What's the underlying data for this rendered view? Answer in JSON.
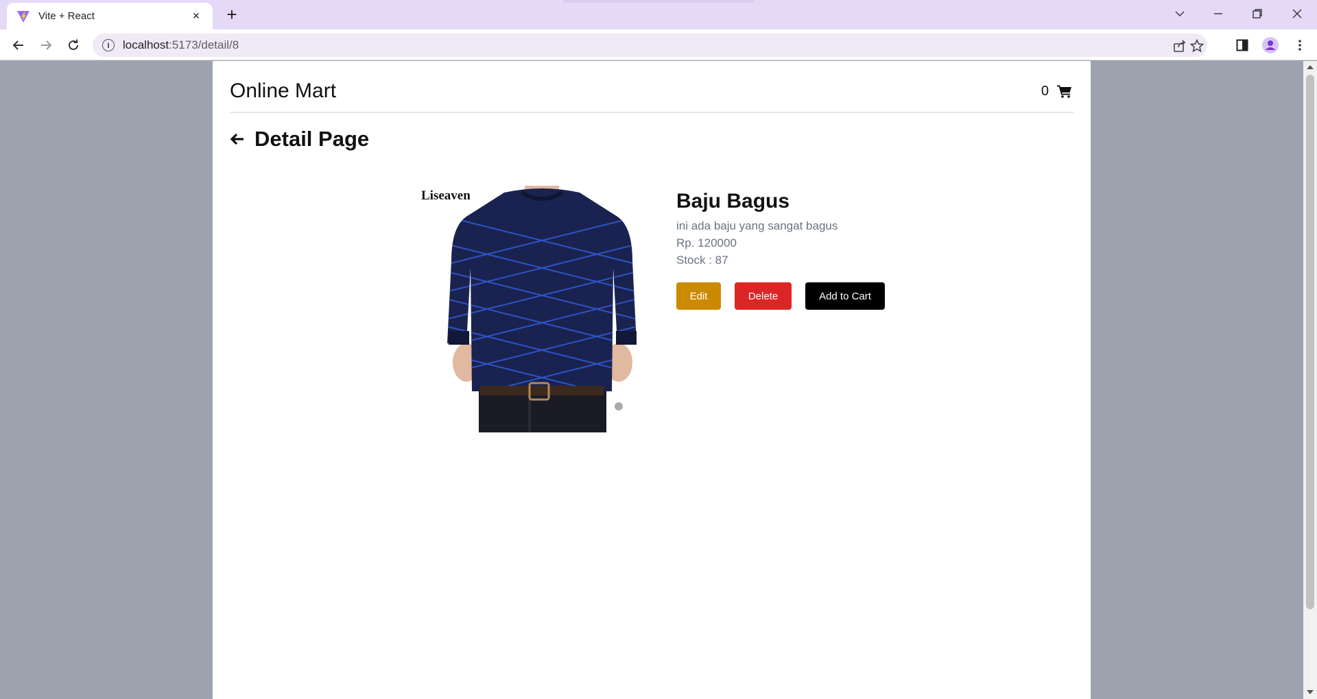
{
  "browser": {
    "tab_title": "Vite + React",
    "tab_close": "×",
    "new_tab": "+",
    "url_host": "localhost",
    "url_path": ":5173/detail/8",
    "info_glyph": "i"
  },
  "header": {
    "brand": "Online Mart",
    "cart_count": "0",
    "cart_icon": "cart-icon"
  },
  "page": {
    "title": "Detail Page",
    "back_icon": "arrow-left-icon"
  },
  "product": {
    "brand_mark": "Liseaven",
    "name": "Baju Bagus",
    "description": "ini ada baju yang sangat bagus",
    "price": "Rp. 120000",
    "stock": "Stock : 87",
    "image_colors": {
      "shirt": "#1a2350",
      "stripes": "#2f54c9",
      "pants": "#1b1b26",
      "skin": "#e0b9a0"
    }
  },
  "actions": {
    "edit_label": "Edit",
    "delete_label": "Delete",
    "add_to_cart_label": "Add to Cart"
  },
  "colors": {
    "edit": "#ca8a04",
    "delete": "#dc2626",
    "cart_button": "#000000",
    "page_background": "#9ca3af",
    "tab_strip": "#e5d9f8"
  }
}
